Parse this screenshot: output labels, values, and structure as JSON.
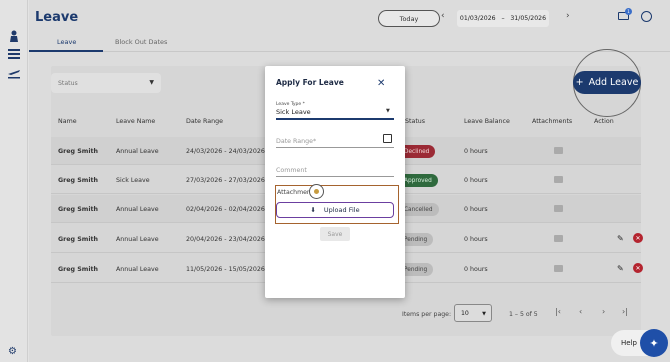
{
  "header": {
    "title": "Leave",
    "today_label": "Today",
    "date_from": "01/03/2026",
    "date_sep": "–",
    "date_to": "31/05/2026",
    "mail_count": "1"
  },
  "tabs": [
    {
      "label": "Leave"
    },
    {
      "label": "Block Out Dates"
    }
  ],
  "filters": {
    "status_placeholder": "Status"
  },
  "add_button": {
    "label": "Add Leave"
  },
  "table": {
    "columns": [
      "Name",
      "Leave Name",
      "Date Range",
      "Status",
      "Leave Balance",
      "Attachments",
      "Action"
    ],
    "rows": [
      {
        "name": "Greg Smith",
        "leave": "Annual Leave",
        "range": "24/03/2026 - 24/03/2026",
        "status": "Declined",
        "balance": "0 hours"
      },
      {
        "name": "Greg Smith",
        "leave": "Sick Leave",
        "range": "27/03/2026 - 27/03/2026",
        "status": "Approved",
        "balance": "0 hours"
      },
      {
        "name": "Greg Smith",
        "leave": "Annual Leave",
        "range": "02/04/2026 - 02/04/2026",
        "status": "Cancelled",
        "balance": "0 hours"
      },
      {
        "name": "Greg Smith",
        "leave": "Annual Leave",
        "range": "20/04/2026 - 23/04/2026",
        "status": "Pending",
        "balance": "0 hours"
      },
      {
        "name": "Greg Smith",
        "leave": "Annual Leave",
        "range": "11/05/2026 - 15/05/2026",
        "status": "Pending",
        "balance": "0 hours"
      }
    ]
  },
  "pagination": {
    "items_per_page_label": "Items per page:",
    "per_page_value": "10",
    "range_label": "1 – 5 of 5"
  },
  "help": {
    "label": "Help"
  },
  "modal": {
    "title": "Apply For Leave",
    "leave_type_label": "Leave Type *",
    "leave_type_value": "Sick Leave",
    "date_range_placeholder": "Date Range*",
    "comment_placeholder": "Comment",
    "attachment_label": "Attachment",
    "upload_label": "Upload File",
    "save_label": "Save"
  },
  "colors": {
    "brand": "#1c3a6e",
    "declined": "#9b2a35",
    "approved": "#2f6a3e",
    "highlight": "#a5632e"
  }
}
